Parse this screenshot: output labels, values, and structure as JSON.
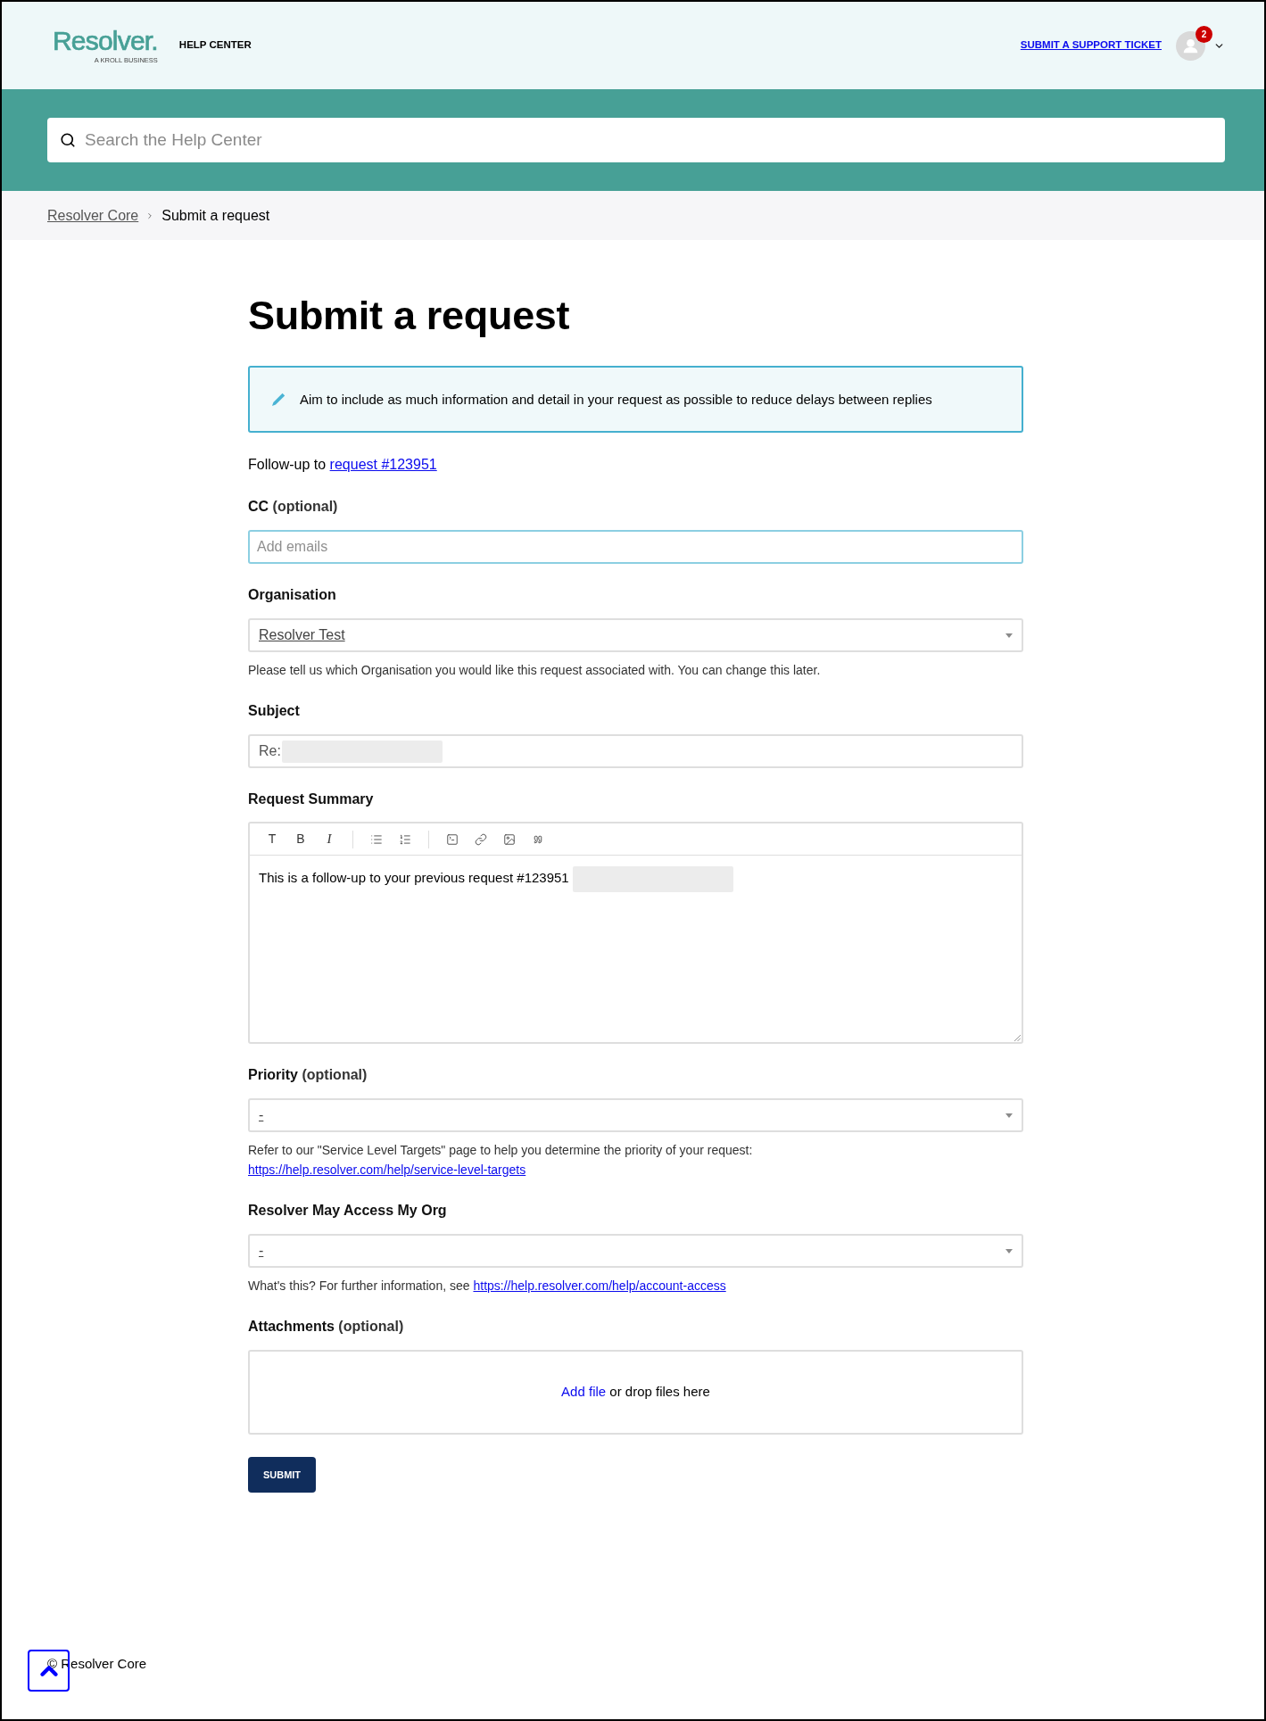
{
  "header": {
    "logo": {
      "name": "Resolver.",
      "tagline": "A KROLL BUSINESS"
    },
    "section": "HELP CENTER",
    "ticket_link": "SUBMIT A SUPPORT TICKET",
    "notifications": "2"
  },
  "search": {
    "placeholder": "Search the Help Center"
  },
  "breadcrumbs": [
    {
      "label": "Resolver Core",
      "link": true
    },
    {
      "label": "Submit a request",
      "link": false
    }
  ],
  "page_title": "Submit a request",
  "notice": "Aim to include as much information and detail in your request as possible to reduce delays between replies",
  "follow_up": {
    "text": "Follow-up to",
    "link": "request #123951"
  },
  "fields": [
    {
      "kind": "email",
      "label": "CC",
      "optional": "(optional)",
      "placeholder": "Add emails",
      "focused": true
    },
    {
      "kind": "select",
      "label": "Organisation",
      "value": "Resolver Test",
      "focused": false,
      "hint": {
        "text": "Please tell us which Organisation you would like this request associated with. You can change this later."
      }
    },
    {
      "kind": "text",
      "label": "Subject",
      "value": "Re:",
      "redacted": true,
      "focused": false
    },
    {
      "kind": "editor",
      "label": "Request Summary",
      "toolbar": [
        [
          {
            "kind": "heading",
            "label": "T"
          },
          {
            "kind": "bold",
            "label": "B"
          },
          {
            "kind": "italic",
            "label": "I"
          }
        ],
        [
          {
            "kind": "bullets"
          },
          {
            "kind": "numbered"
          }
        ],
        [
          {
            "kind": "code"
          },
          {
            "kind": "link"
          },
          {
            "kind": "image"
          },
          {
            "kind": "quote"
          }
        ]
      ],
      "value": "This is a follow-up to your previous request #123951",
      "redacted": true,
      "focused": false
    },
    {
      "kind": "select",
      "label": "Priority",
      "optional": "(optional)",
      "value": "-",
      "focused": false,
      "hint": {
        "text": "Refer to our \"Service Level Targets\" page to help you determine the priority of your request:",
        "link": "https://help.resolver.com/help/service-level-targets"
      }
    },
    {
      "kind": "select",
      "label": "Resolver May Access My Org",
      "value": "-",
      "focused": false,
      "hint": {
        "text": "What's this? For further information, see",
        "link": "https://help.resolver.com/help/account-access"
      }
    },
    {
      "kind": "attachments",
      "label": "Attachments",
      "optional": "(optional)",
      "link": "Add file",
      "text": "or drop files here",
      "focused": false
    }
  ],
  "submit": "SUBMIT",
  "footer": {
    "copyright": "© Resolver Core"
  }
}
